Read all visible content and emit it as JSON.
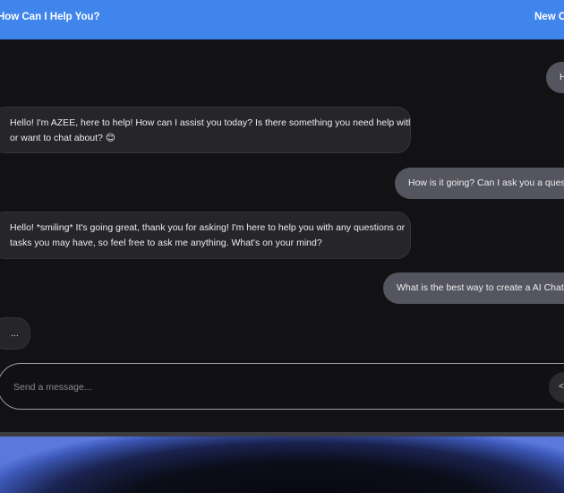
{
  "header": {
    "title": "How Can I Help You?",
    "new_chat_label": "New Chat"
  },
  "messages": [
    {
      "role": "user",
      "text": "Hi"
    },
    {
      "role": "assistant",
      "lines": [
        "Hello! I'm AZEE, here to help! How can I assist you today? Is there something you need help with",
        "or want to chat about? 😊"
      ]
    },
    {
      "role": "user",
      "text": "How is it going? Can I ask you a question?"
    },
    {
      "role": "assistant",
      "lines": [
        "Hello! *smiling* It's going great, thank you for asking! I'm here to help you with any questions or",
        "tasks you may have, so feel free to ask me anything. What's on your mind?"
      ]
    },
    {
      "role": "user",
      "text": "What is the best way to create a AI Chatbot?"
    },
    {
      "role": "assistant",
      "text": "..."
    }
  ],
  "composer": {
    "placeholder": "Send a message...",
    "send_label": "<"
  },
  "colors": {
    "header_bg": "#3f85ec",
    "chat_bg": "#121214",
    "user_bubble": "#55555f",
    "bot_bubble": "#25252a"
  }
}
